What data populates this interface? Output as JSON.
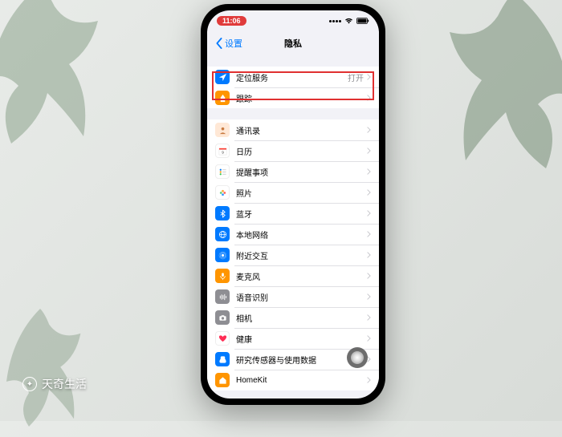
{
  "status": {
    "time": "11:06"
  },
  "nav": {
    "back": "设置",
    "title": "隐私"
  },
  "sections": [
    [
      {
        "label": "定位服务",
        "value": "打开"
      },
      {
        "label": "跟踪",
        "value": ""
      }
    ],
    [
      {
        "label": "通讯录",
        "value": ""
      },
      {
        "label": "日历",
        "value": ""
      },
      {
        "label": "提醒事项",
        "value": ""
      },
      {
        "label": "照片",
        "value": ""
      },
      {
        "label": "蓝牙",
        "value": ""
      },
      {
        "label": "本地网络",
        "value": ""
      },
      {
        "label": "附近交互",
        "value": ""
      },
      {
        "label": "麦克风",
        "value": ""
      },
      {
        "label": "语音识别",
        "value": ""
      },
      {
        "label": "相机",
        "value": ""
      },
      {
        "label": "健康",
        "value": ""
      },
      {
        "label": "研究传感器与使用数据",
        "value": ""
      },
      {
        "label": "HomeKit",
        "value": ""
      }
    ]
  ],
  "watermark": "天奇生活"
}
